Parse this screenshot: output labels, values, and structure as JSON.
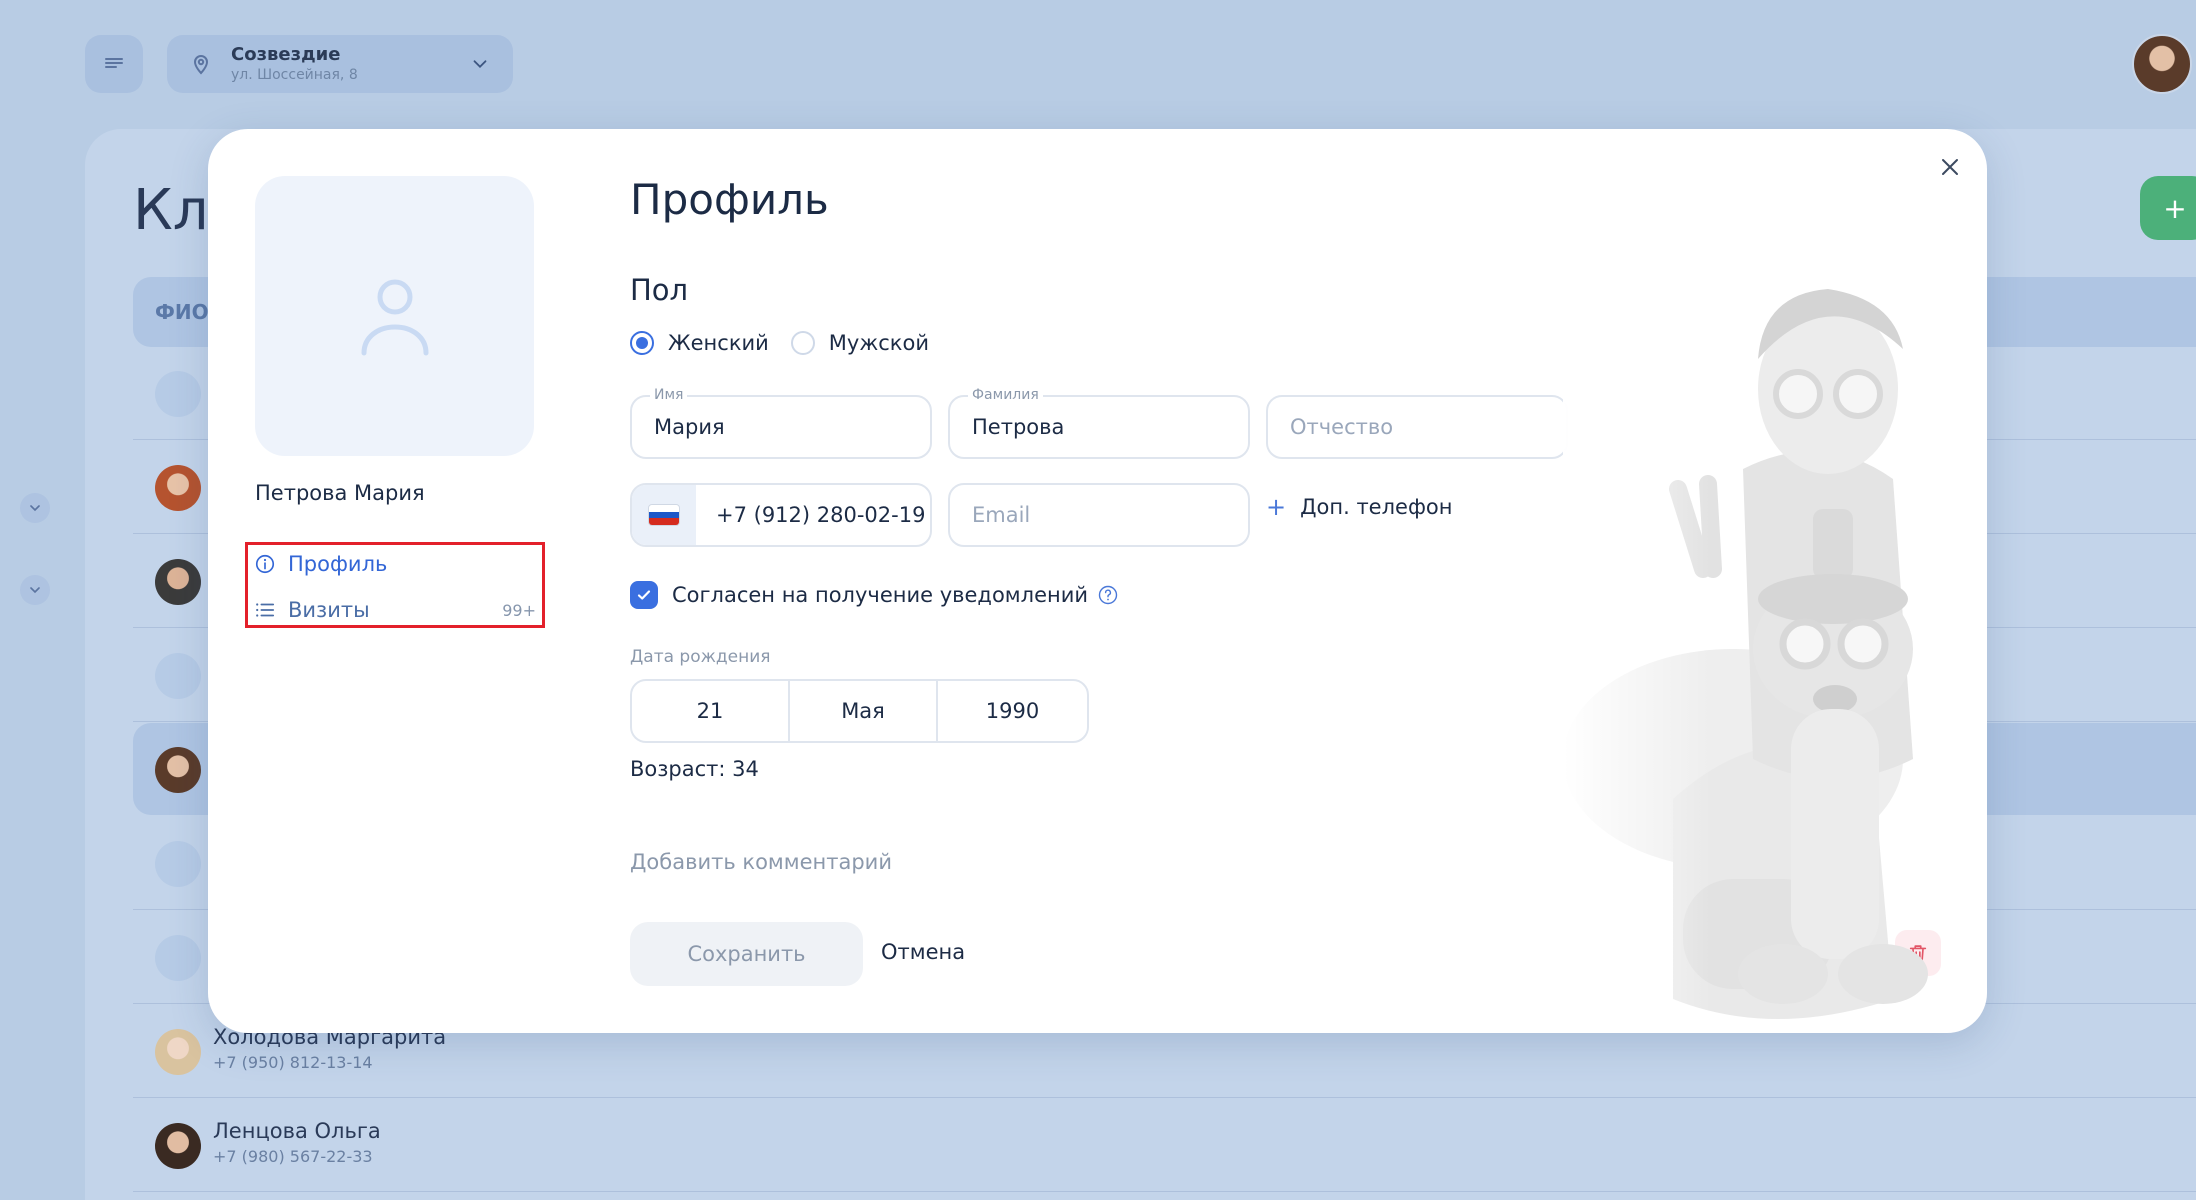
{
  "topbar": {
    "menu_icon": "menu-icon",
    "location_name": "Созвездие",
    "location_address": "ул. Шоссейная, 8"
  },
  "background": {
    "page_title": "Кл",
    "column_fio": "ФИО",
    "add_button": "+",
    "clients": [
      {
        "name": "Холодова Маргарита",
        "phone": "+7 (950) 812-13-14"
      },
      {
        "name": "Ленцова Ольга",
        "phone": "+7 (980) 567-22-33"
      }
    ]
  },
  "modal": {
    "client_name": "Петрова Мария",
    "nav": {
      "profile_label": "Профиль",
      "visits_label": "Визиты",
      "visits_badge": "99+"
    },
    "title": "Профиль",
    "gender": {
      "label": "Пол",
      "options": [
        "Женский",
        "Мужской"
      ],
      "selected": "Женский"
    },
    "fields": {
      "first_name_label": "Имя",
      "first_name_value": "Мария",
      "last_name_label": "Фамилия",
      "last_name_value": "Петрова",
      "middle_name_placeholder": "Отчество",
      "phone_value": "+7 (912) 280-02-19",
      "email_placeholder": "Email"
    },
    "add_phone_label": "Доп. телефон",
    "consent_label": "Согласен на получение уведомлений",
    "consent_checked": true,
    "dob": {
      "label": "Дата рождения",
      "day": "21",
      "month": "Мая",
      "year": "1990"
    },
    "age_text": "Возраст: 34",
    "add_comment_label": "Добавить комментарий",
    "save_label": "Сохранить",
    "cancel_label": "Отмена"
  },
  "colors": {
    "accent": "#3a6fe0",
    "backdrop": "#b8cce4",
    "highlight": "#e3202a",
    "fab": "#4cb07a",
    "delete_bg": "#fdecef",
    "delete_icon": "#e25566"
  }
}
